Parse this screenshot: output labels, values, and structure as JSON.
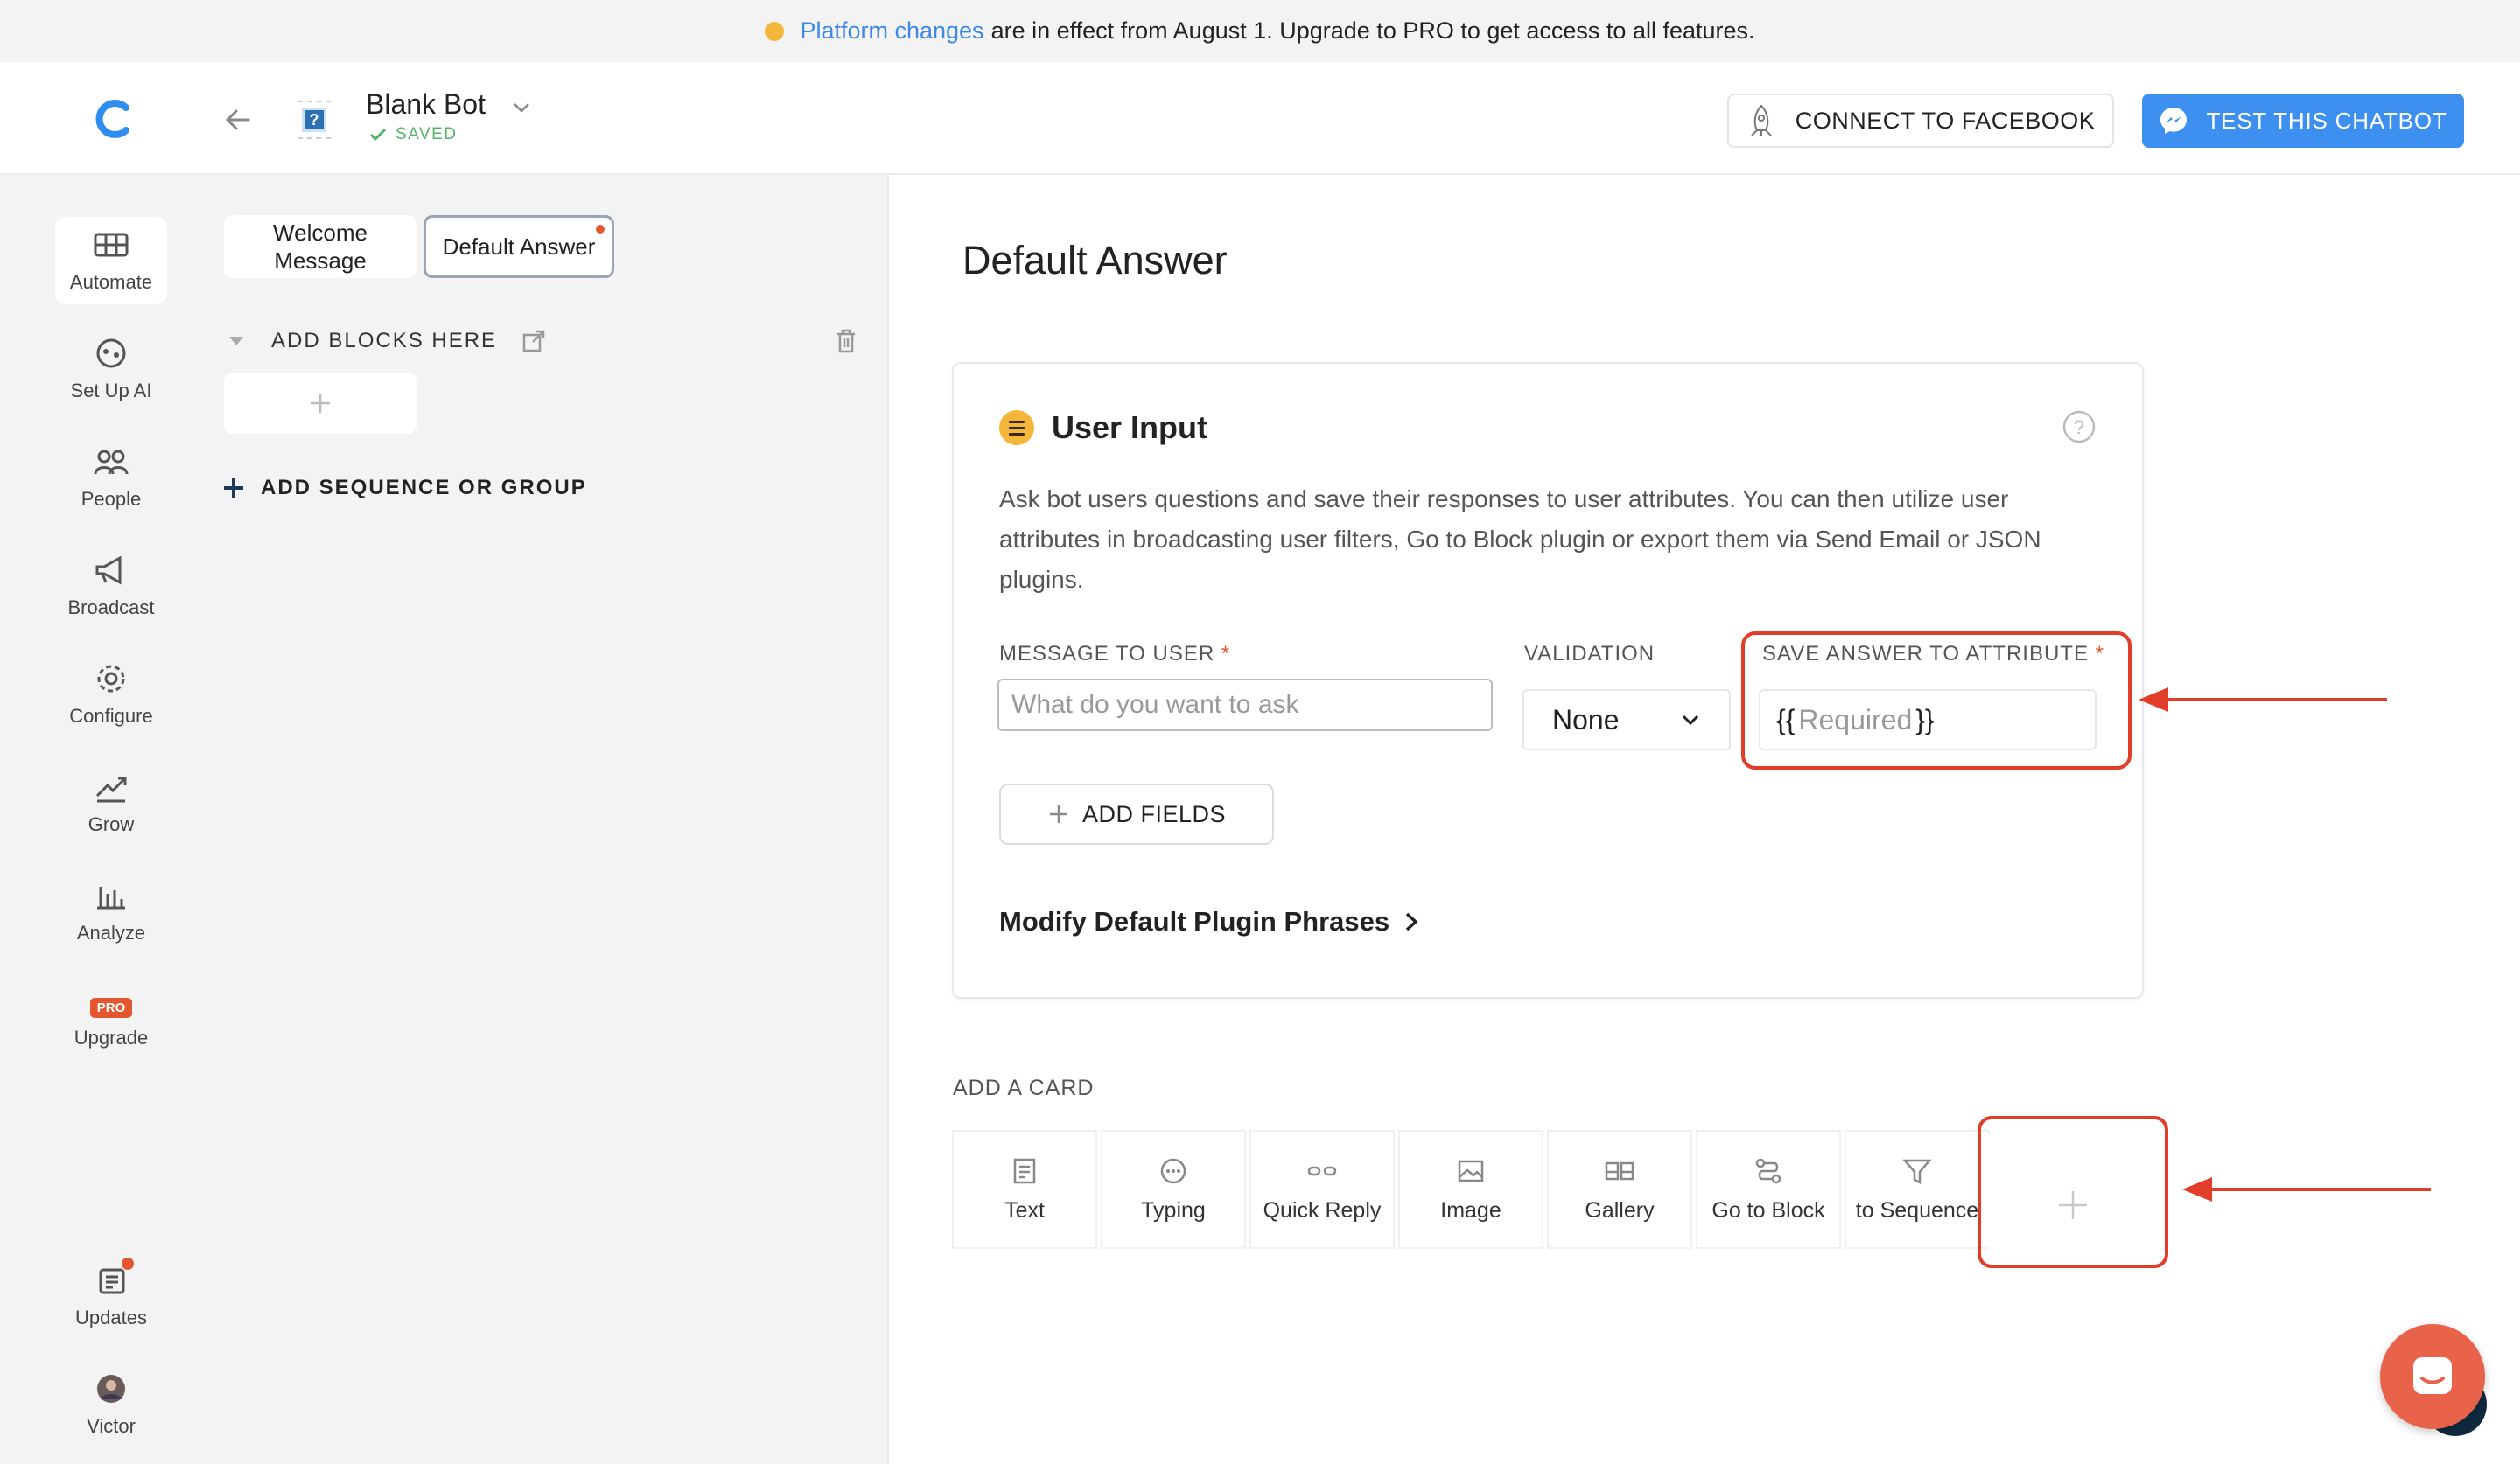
{
  "banner": {
    "link_text": "Platform changes",
    "text": "are in effect from August 1. Upgrade to PRO to get access to all features."
  },
  "header": {
    "bot_name": "Blank Bot",
    "saved_label": "SAVED",
    "connect_facebook": "CONNECT TO FACEBOOK",
    "test_chatbot": "TEST THIS CHATBOT"
  },
  "nav": {
    "items": [
      {
        "label": "Automate",
        "icon": "automate-icon"
      },
      {
        "label": "Set Up AI",
        "icon": "ai-icon"
      },
      {
        "label": "People",
        "icon": "people-icon"
      },
      {
        "label": "Broadcast",
        "icon": "megaphone-icon"
      },
      {
        "label": "Configure",
        "icon": "gear-icon"
      },
      {
        "label": "Grow",
        "icon": "grow-icon"
      },
      {
        "label": "Analyze",
        "icon": "chart-icon"
      },
      {
        "label": "Upgrade",
        "icon": "pro-badge",
        "badge": "PRO"
      },
      {
        "label": "Updates",
        "icon": "updates-icon"
      },
      {
        "label": "Victor",
        "icon": "avatar"
      }
    ]
  },
  "blocks": {
    "welcome": "Welcome Message",
    "default_answer": "Default Answer",
    "group_title": "ADD BLOCKS HERE",
    "add_sequence": "ADD SEQUENCE OR GROUP"
  },
  "main": {
    "title": "Default Answer",
    "card": {
      "title": "User Input",
      "description": "Ask bot users questions and save their responses to user attributes. You can then utilize user attributes in broadcasting user filters, Go to Block plugin or export them via Send Email or JSON plugins.",
      "message_label": "MESSAGE TO USER",
      "message_placeholder": "What do you want to ask",
      "validation_label": "VALIDATION",
      "validation_value": "None",
      "save_label": "SAVE ANSWER TO ATTRIBUTE",
      "attr_open": "{{",
      "attr_placeholder": "Required",
      "attr_close": "}}",
      "required_mark": "*",
      "add_fields": "ADD FIELDS",
      "modify": "Modify Default Plugin Phrases"
    },
    "add_card_label": "ADD A CARD",
    "card_types": [
      "Text",
      "Typing",
      "Quick Reply",
      "Image",
      "Gallery",
      "Go to Block",
      "to Sequence"
    ]
  },
  "colors": {
    "accent": "#3d8ff0",
    "highlight": "#e23d28",
    "badge": "#e4572e"
  }
}
